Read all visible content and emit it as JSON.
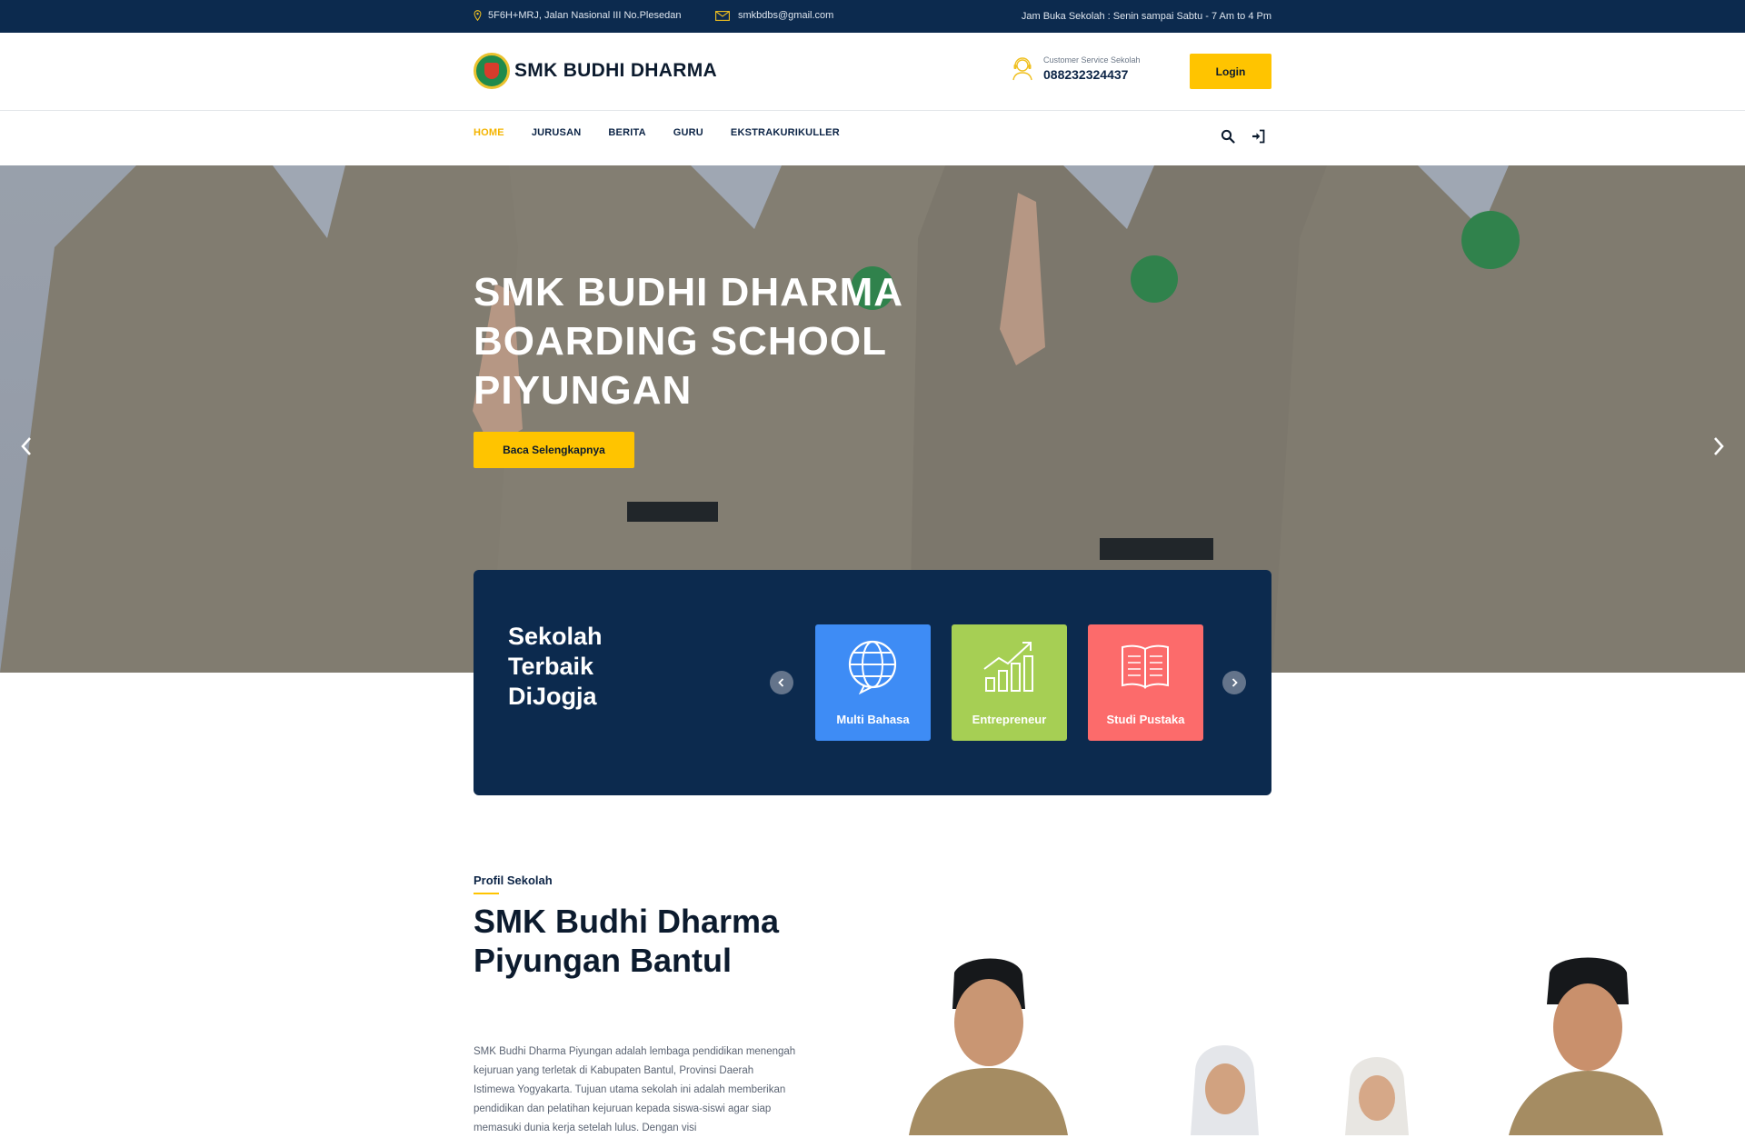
{
  "topbar": {
    "address": "5F6H+MRJ, Jalan Nasional III No.Plesedan",
    "email": "smkbdbs@gmail.com",
    "hours": "Jam Buka Sekolah : Senin sampai Sabtu - 7 Am to 4 Pm",
    "icons": [
      "pin-icon",
      "mail-icon"
    ]
  },
  "header": {
    "logo_text": "SMK BUDHI DHARMA",
    "cs_label": "Customer Service Sekolah",
    "cs_phone": "088232324437",
    "login_label": "Login",
    "cs_icon": "headset-icon"
  },
  "nav": {
    "items": [
      {
        "label": "HOME",
        "active": true
      },
      {
        "label": "JURUSAN",
        "active": false
      },
      {
        "label": "BERITA",
        "active": false
      },
      {
        "label": "GURU",
        "active": false
      },
      {
        "label": "EKSTRAKURIKULLER",
        "active": false
      }
    ],
    "tools": [
      "search-icon",
      "sign-in-icon"
    ]
  },
  "hero": {
    "title": "SMK BUDHI DHARMA BOARDING SCHOOL PIYUNGAN",
    "button_label": "Baca Selengkapnya",
    "arrows": [
      "chevron-left-icon",
      "chevron-right-icon"
    ]
  },
  "feature": {
    "title": "Sekolah Terbaik DiJogja",
    "cards": [
      {
        "label": "Multi Bahasa",
        "icon": "globe-icon",
        "color": "#3e8cf5"
      },
      {
        "label": "Entrepreneur",
        "icon": "growth-chart-icon",
        "color": "#a6cf54"
      },
      {
        "label": "Studi Pustaka",
        "icon": "book-icon",
        "color": "#fc6b6b"
      }
    ]
  },
  "profile": {
    "kicker": "Profil Sekolah",
    "title": "SMK Budhi Dharma Piyungan Bantul",
    "description": "SMK Budhi Dharma Piyungan adalah lembaga pendidikan menengah kejuruan yang terletak di Kabupaten Bantul, Provinsi Daerah Istimewa Yogyakarta. Tujuan utama sekolah ini adalah memberikan pendidikan dan pelatihan kejuruan kepada siswa-siswi agar siap memasuki dunia kerja setelah lulus. Dengan visi"
  },
  "colors": {
    "navy": "#0c2a4e",
    "accent": "#ffc400",
    "nav_active": "#f4b400"
  }
}
